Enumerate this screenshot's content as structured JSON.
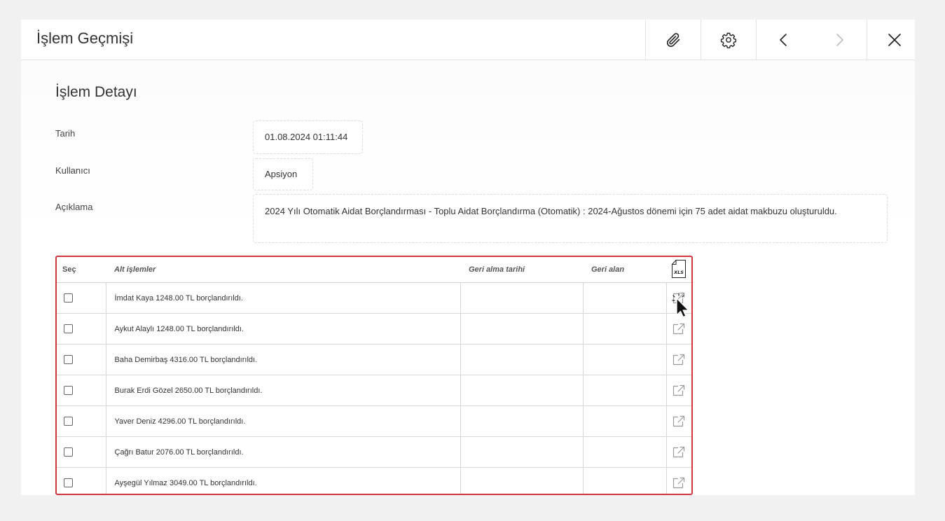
{
  "header": {
    "title": "İşlem Geçmişi",
    "toolbar": [
      {
        "name": "attach-button",
        "icon": "paperclip-icon"
      },
      {
        "name": "settings-button",
        "icon": "gear-icon"
      },
      {
        "name": "previous-button",
        "icon": "chevron-left-icon"
      },
      {
        "name": "next-button",
        "icon": "chevron-right-icon"
      },
      {
        "name": "close-button",
        "icon": "close-icon"
      }
    ]
  },
  "detail": {
    "title": "İşlem Detayı",
    "date_label": "Tarih",
    "date_value": "01.08.2024 01:11:44",
    "user_label": "Kullanıcı",
    "user_value": "Apsiyon",
    "desc_label": "Açıklama",
    "desc_value": "2024 Yılı Otomatik Aidat Borçlandırması - Toplu Aidat Borçlandırma (Otomatik) : 2024-Ağustos dönemi için 75 adet aidat makbuzu oluşturuldu."
  },
  "table": {
    "headers": {
      "select": "Seç",
      "sub_ops": "Alt işlemler",
      "undo_date": "Geri alma tarihi",
      "undone_by": "Geri alan",
      "export_icon": "xls-export-icon",
      "export_text": "XLS"
    },
    "rows": [
      {
        "text": "İmdat Kaya 1248.00 TL borçlandırıldı.",
        "undo_date": "",
        "undone_by": ""
      },
      {
        "text": "Aykut Alaylı 1248.00 TL borçlandırıldı.",
        "undo_date": "",
        "undone_by": ""
      },
      {
        "text": "Baha Demirbaş 4316.00 TL borçlandırıldı.",
        "undo_date": "",
        "undone_by": ""
      },
      {
        "text": "Burak Erdi Gözel 2650.00 TL borçlandırıldı.",
        "undo_date": "",
        "undone_by": ""
      },
      {
        "text": "Yaver Deniz 4296.00 TL borçlandırıldı.",
        "undo_date": "",
        "undone_by": ""
      },
      {
        "text": "Çağrı Batur 2076.00 TL borçlandırıldı.",
        "undo_date": "",
        "undone_by": ""
      },
      {
        "text": "Ayşegül Yılmaz 3049.00 TL borçlandırıldı.",
        "undo_date": "",
        "undone_by": ""
      }
    ]
  },
  "colors": {
    "highlight_border": "#d1343f",
    "border": "#d6d6d6",
    "text": "#333333"
  }
}
